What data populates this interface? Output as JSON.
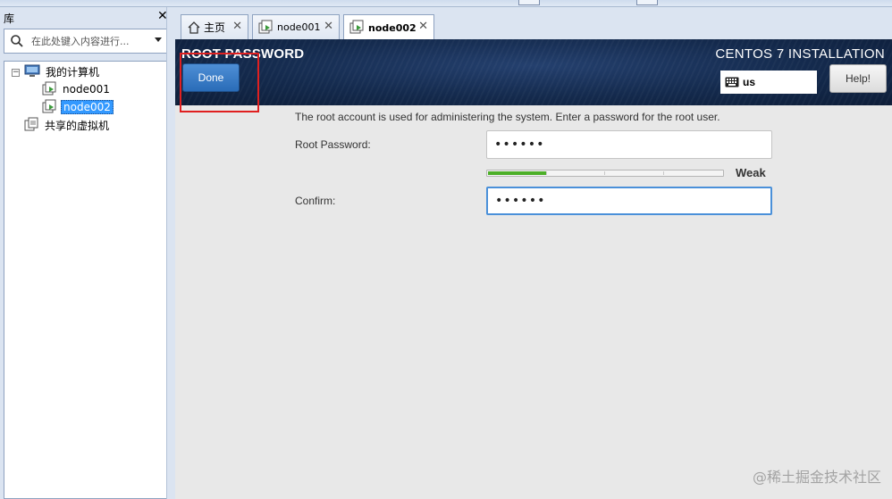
{
  "library": {
    "title": "库",
    "close_icon": "close-icon",
    "search": {
      "placeholder": "在此处键入内容进行..."
    },
    "tree": {
      "root_label": "我的计算机",
      "items": [
        {
          "label": "node001",
          "selected": false
        },
        {
          "label": "node002",
          "selected": true
        }
      ],
      "shared_label": "共享的虚拟机"
    }
  },
  "tabs": [
    {
      "label": "主页",
      "icon": "home-icon",
      "active": false
    },
    {
      "label": "node001",
      "icon": "vm-icon",
      "active": false
    },
    {
      "label": "node002",
      "icon": "vm-icon",
      "active": true
    }
  ],
  "installer": {
    "page_title": "ROOT PASSWORD",
    "installer_title": "CENTOS 7 INSTALLATION",
    "done_label": "Done",
    "help_label": "Help!",
    "keyboard_layout": "us",
    "intro_text": "The root account is used for administering the system.  Enter a password for the root user.",
    "root_password_label": "Root Password:",
    "root_password_value": "••••••",
    "confirm_label": "Confirm:",
    "confirm_value": "••••••",
    "strength_label": "Weak",
    "strength_fraction": 0.25,
    "colors": {
      "accent": "#2a6cb8",
      "strength": "#4caf28",
      "highlight": "#e02020",
      "header": "#142a4d"
    }
  },
  "watermark": "@稀土掘金技术社区"
}
